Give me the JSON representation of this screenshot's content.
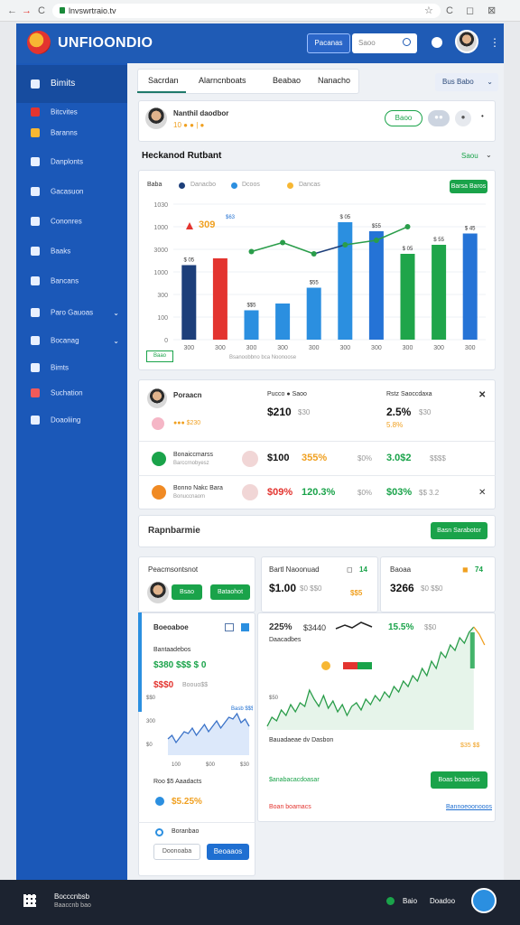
{
  "browser": {
    "url": "lnvswrtraio.tv",
    "back": "←",
    "forward": "→",
    "reload": "C",
    "bookmark": "☆",
    "reload2": "C",
    "minimize": "◻",
    "close": "⊠"
  },
  "header": {
    "title": "UNFIOONDIO",
    "filter_label": "Pacanas",
    "search_placeholder": "Saoo",
    "more": "⋮"
  },
  "sidebar": {
    "items": [
      {
        "label": "Bimits",
        "icon": "grid-icon"
      },
      {
        "label": "Bitcvites",
        "icon": "flag-icon"
      },
      {
        "label": "Baranns",
        "icon": "folder-icon"
      },
      {
        "label": "Danplonts",
        "icon": "clock-icon"
      },
      {
        "label": "Gacasuon",
        "icon": "brush-icon"
      },
      {
        "label": "Cononres",
        "icon": "lock-icon"
      },
      {
        "label": "Baaks",
        "icon": "bird-icon"
      },
      {
        "label": "Bancans",
        "icon": "home-icon"
      },
      {
        "label": "Paro Gauoas",
        "icon": "calendar-icon"
      },
      {
        "label": "Bocanag",
        "icon": "dollar-icon"
      },
      {
        "label": "Bimts",
        "icon": "target-icon"
      },
      {
        "label": "Suchation",
        "icon": "gift-icon"
      },
      {
        "label": "Doaoliing",
        "icon": "server-icon"
      }
    ]
  },
  "tabs": [
    "Sacrdan",
    "Alarncnboats",
    "Beabao",
    "Nanacho"
  ],
  "tab_dropdown": "Bus  Babo",
  "profile_card": {
    "name": "Nanthil daodbor",
    "meta": "10 ●   ●  | ●",
    "pill1": "Baoo",
    "btn1": "●●",
    "btn2": "●",
    "more": "•"
  },
  "section1": {
    "title": "Heckanod Rutbant",
    "action": "Saou"
  },
  "legend": [
    "Baba",
    "Danacbo",
    "Dcoos",
    "Dancas"
  ],
  "chart_button": "Barsa Baros",
  "chart_badge": "Baao",
  "chart_caption": "Bsanoobbno bca  Noonoose",
  "chart_data": {
    "type": "bar",
    "categories": [
      "300",
      "300",
      "300",
      "300",
      "300",
      "300",
      "300",
      "300",
      "300",
      "300"
    ],
    "ylim": [
      0,
      600
    ],
    "yticks": [
      "0",
      "100",
      "300",
      "1000",
      "3000",
      "1000",
      "1030"
    ],
    "series": [
      {
        "values": [
          330,
          360,
          130,
          160,
          230,
          520,
          480,
          380,
          420,
          470
        ],
        "color_list": [
          "#1d3f7a",
          "#e3342f",
          "#2b8fe0",
          "#2b8fe0",
          "#2b8fe0",
          "#2b8fe0",
          "#2573d6",
          "#1fa54a",
          "#1fa54a",
          "#2573d6"
        ]
      }
    ],
    "line": [
      null,
      null,
      390,
      430,
      380,
      420,
      440,
      500
    ],
    "bar_labels": [
      "$ 05",
      "",
      "$$5",
      "",
      "$55",
      "$ 05",
      "$55",
      "$ 05",
      "$ 55",
      "$ 45"
    ],
    "annotation1": "309",
    "annotation2": "$63"
  },
  "stats_card": {
    "row1": {
      "name": "Poraacn",
      "sub": "●●● $230",
      "col2_label": "Pucco  ● Saoo",
      "col2_value": "$210",
      "col2_sub": "$30",
      "col3_label": "Rstz Saoccdaxa",
      "col3_value": "2.5%",
      "col3_sub": "$30",
      "col3_sub2": "5.8%",
      "close": "✕"
    },
    "row2": {
      "name": "Bonaiccmarss",
      "sub": "Barccrnobyesz",
      "v1": "$100",
      "v2": "355%",
      "v3": "$0%",
      "v4": "3.0$2",
      "v5": "$$$$"
    },
    "row3": {
      "name": "Bonno Nakc Bara",
      "sub": "Bonuccnaom",
      "v1": "$09%",
      "v2": "120.3%",
      "v3": "$0%",
      "v4": "$03%",
      "v5": "$$ 3.2",
      "close": "✕"
    }
  },
  "section2": {
    "title": "Rapnbarmie",
    "action": "Basn Sarabotor"
  },
  "bottom_cards": {
    "c1": {
      "title": "Peacmsontsnot",
      "btn1": "Bsao",
      "btn2": "Bataohot"
    },
    "c2": {
      "title": "Bartl Naoonuad",
      "value": "$1.00",
      "sub": "$0 $$0",
      "badge": "$$5",
      "icon": "14"
    },
    "c3": {
      "title": "Baoaa",
      "value": "3266",
      "sub": "$0 $$0",
      "icon": "74"
    }
  },
  "watch_card": {
    "title": "Boeoaboe",
    "label": "Bantaadebos",
    "value": "$380  $$$ $ 0",
    "value2": "$$$0",
    "value2_sub": "Boouo$$",
    "chart_label": "Basb $$$",
    "yticks": [
      "$$0",
      "300",
      "$0"
    ],
    "xticks": [
      "100",
      "$00",
      "$30"
    ],
    "foot_label": "Roo $5 Aaadacts",
    "foot_value": "$5.25%",
    "foot_label2": "Boranbao",
    "btn_cancel": "Doonoaba",
    "btn_ok": "Beoaaos"
  },
  "market_card": {
    "v1": "225%",
    "v2": "$3440",
    "v3": "15.5%",
    "v4": "$$0",
    "sub": "Daacadbes",
    "label": "Bauadaeae dv Dasbon",
    "label_value": "$35 $$",
    "foot_left": "$anabacacdoasar",
    "foot_btn": "Boas boaasios",
    "foot_left2": "Boan boamacs",
    "foot_link": "Bannoeoonooos"
  },
  "taskbar": {
    "app_label": "Bocccnbsb",
    "app_sub": "Baaccnb bao",
    "status1": "Baio",
    "status2": "Doadoo"
  },
  "colors": {
    "primary": "#1f5bb5",
    "sidebar": "#1b58b8",
    "green": "#1aa34a",
    "red": "#e3342f",
    "chart_line": "#2a9d4a"
  }
}
